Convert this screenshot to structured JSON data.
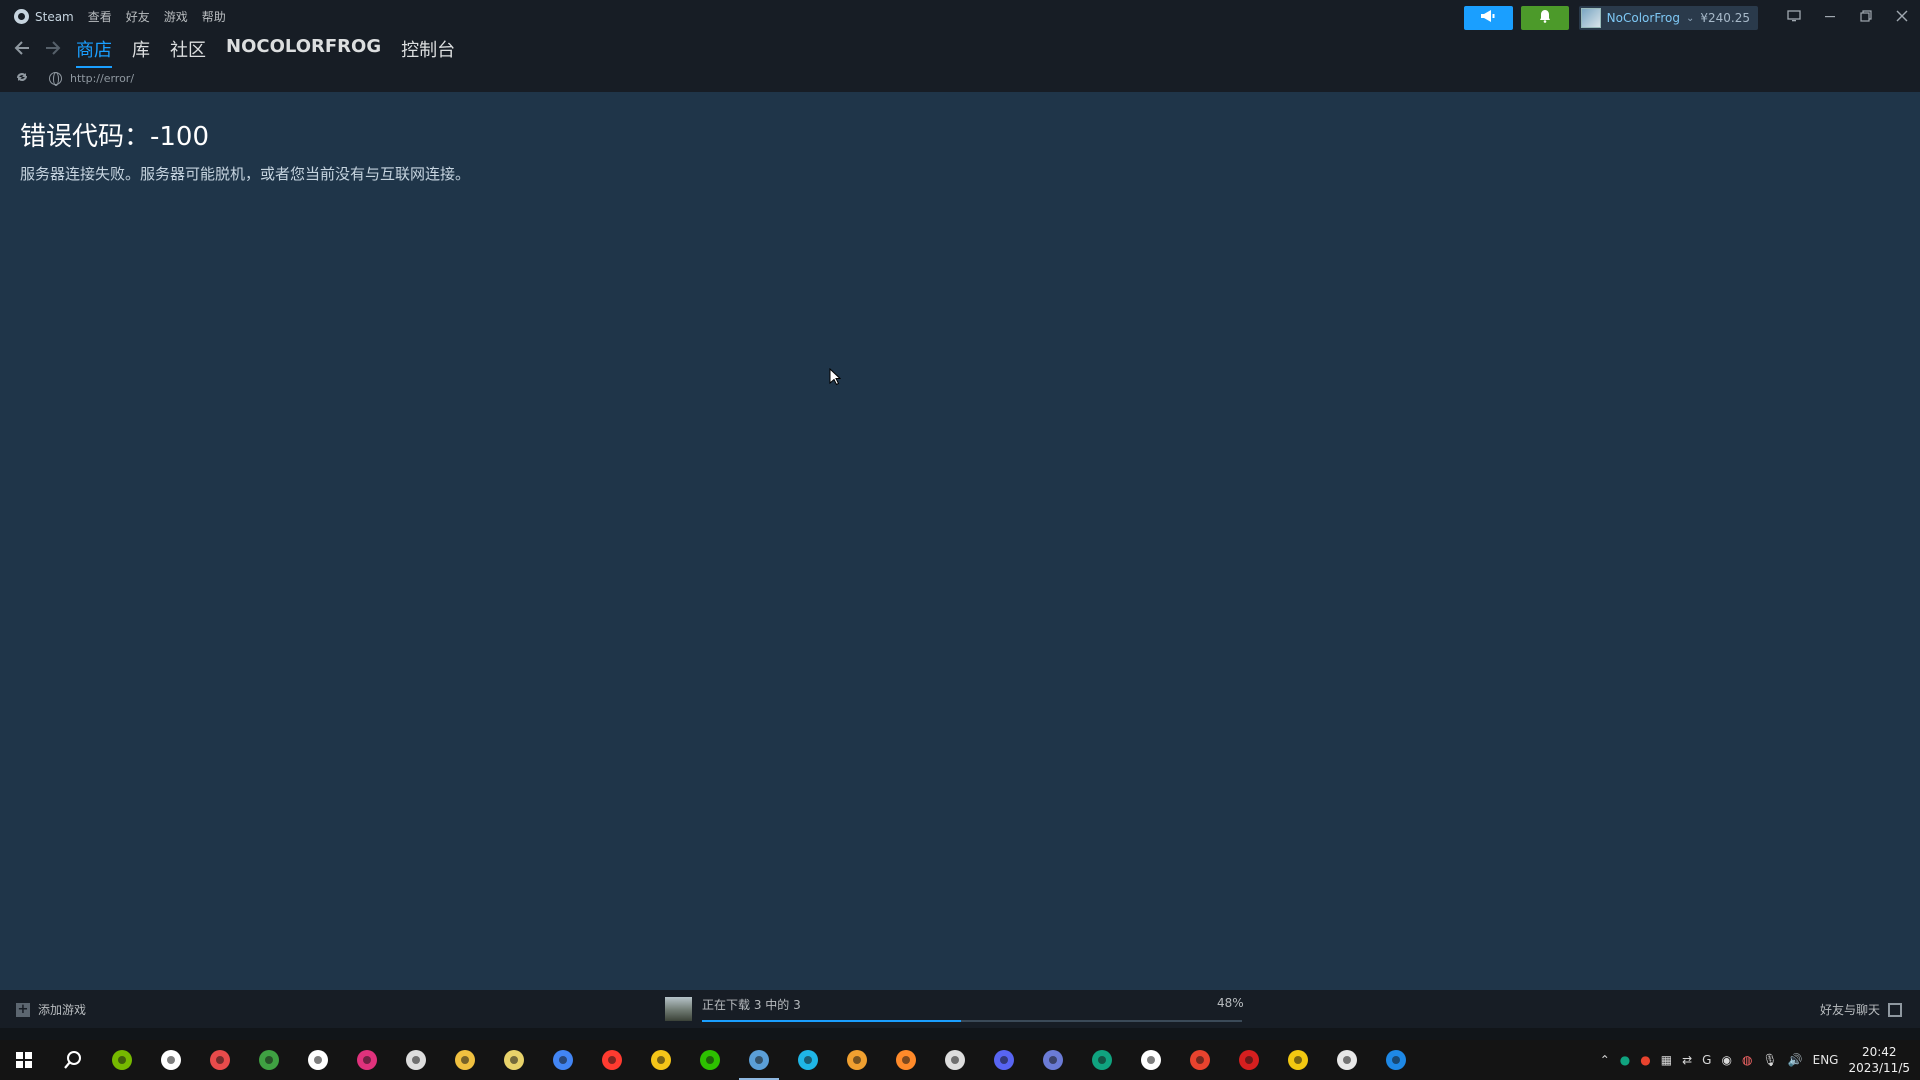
{
  "menu": {
    "app": "Steam",
    "items": [
      "查看",
      "好友",
      "游戏",
      "帮助"
    ]
  },
  "account": {
    "name": "NoColorFrog",
    "balance": "¥240.25"
  },
  "nav": {
    "tabs": [
      "商店",
      "库",
      "社区",
      "NOCOLORFROG",
      "控制台"
    ],
    "active": "商店"
  },
  "url": "http://error/",
  "error": {
    "title": "错误代码：-100",
    "message": "服务器连接失败。服务器可能脱机，或者您当前没有与互联网连接。"
  },
  "bottom": {
    "add_game": "添加游戏",
    "download_label": "正在下载 3 中的 3",
    "download_percent_text": "48%",
    "download_progress": 0.48,
    "friends_chat": "好友与聊天"
  },
  "taskbar": {
    "icons": [
      {
        "name": "windows-start-icon",
        "color": "#ffffff"
      },
      {
        "name": "search-icon",
        "color": "#ffffff"
      },
      {
        "name": "nvidia-icon",
        "color": "#76b900"
      },
      {
        "name": "app-ring-icon",
        "color": "#ffffff"
      },
      {
        "name": "app-bluetooth-icon",
        "color": "#e84b4b"
      },
      {
        "name": "xbox-icon",
        "color": "#3fa142"
      },
      {
        "name": "capcut-icon",
        "color": "#ffffff"
      },
      {
        "name": "adobe-icon",
        "color": "#e0327c"
      },
      {
        "name": "app-cloud-icon",
        "color": "#dddddd"
      },
      {
        "name": "file-explorer-icon",
        "color": "#f0c040"
      },
      {
        "name": "notepad-icon",
        "color": "#e8d26a"
      },
      {
        "name": "chrome-icon",
        "color": "#4285f4"
      },
      {
        "name": "app-speed-icon",
        "color": "#ff3b30"
      },
      {
        "name": "app-yellow-icon",
        "color": "#f5c518"
      },
      {
        "name": "wechat-icon",
        "color": "#2dc100"
      },
      {
        "name": "steam-icon",
        "color": "#5b9fd8"
      },
      {
        "name": "app-cyan-icon",
        "color": "#1fb6e6"
      },
      {
        "name": "app-orange-icon",
        "color": "#f0a030"
      },
      {
        "name": "app-g-icon",
        "color": "#ff8a2a"
      },
      {
        "name": "app-gauge-icon",
        "color": "#dddddd"
      },
      {
        "name": "discord-icon",
        "color": "#5865f2"
      },
      {
        "name": "app-keyboard-icon",
        "color": "#6b7bd6"
      },
      {
        "name": "chatgpt-icon",
        "color": "#10a37f"
      },
      {
        "name": "logitech-icon",
        "color": "#ffffff"
      },
      {
        "name": "app-red-icon",
        "color": "#e8432e"
      },
      {
        "name": "app-red-box-icon",
        "color": "#d61f1f"
      },
      {
        "name": "app-yellow-box-icon",
        "color": "#f2c811"
      },
      {
        "name": "roblox-icon",
        "color": "#e8e8e8"
      },
      {
        "name": "app-blue-m-icon",
        "color": "#1e88e5"
      }
    ],
    "active_icon": "steam-icon",
    "tray_lang": "ENG",
    "time": "20:42",
    "date": "2023/11/5"
  }
}
